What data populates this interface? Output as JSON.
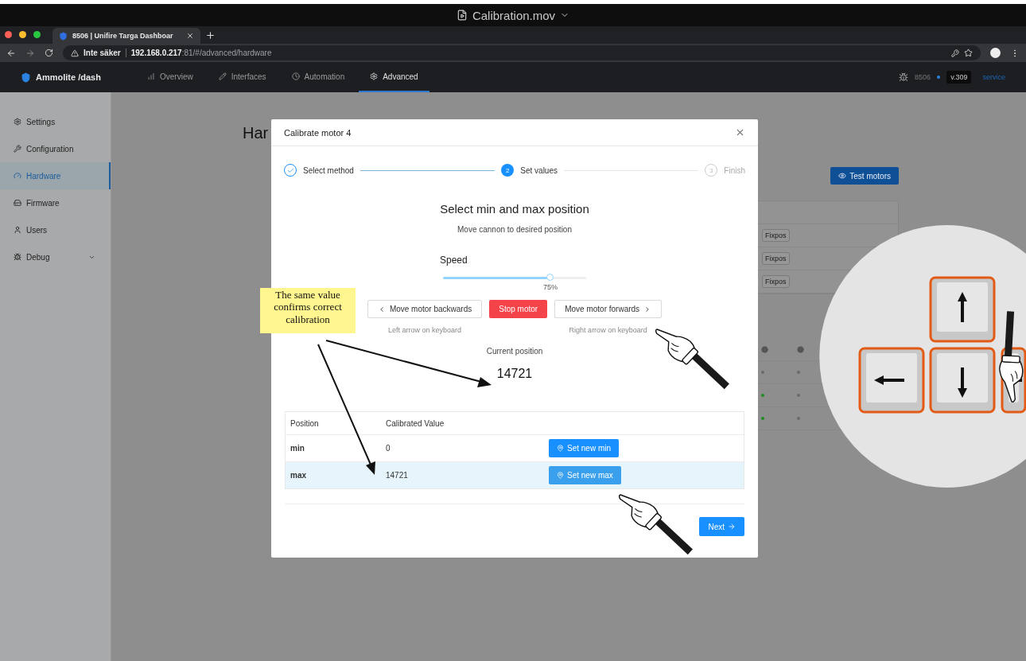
{
  "video_title": "Calibration.mov",
  "browser": {
    "tab_title": "8506 | Unifire Targa Dashboar",
    "security": "Inte säker",
    "url": "**192.168.0.217**:81/#/advanced/hardware"
  },
  "app_nav": {
    "brand": "Ammolite /dash",
    "items": [
      {
        "label": "Overview",
        "selected": false
      },
      {
        "label": "Interfaces",
        "selected": false
      },
      {
        "label": "Automation",
        "selected": false
      },
      {
        "label": "Advanced",
        "selected": true
      }
    ],
    "device": "8506",
    "version": "v.309",
    "service_link": "service"
  },
  "sidebar": {
    "items": [
      {
        "label": "Settings",
        "selected": false,
        "expandable": false
      },
      {
        "label": "Configuration",
        "selected": false,
        "expandable": false
      },
      {
        "label": "Hardware",
        "selected": true,
        "expandable": false
      },
      {
        "label": "Firmware",
        "selected": false,
        "expandable": false
      },
      {
        "label": "Users",
        "selected": false,
        "expandable": false
      },
      {
        "label": "Debug",
        "selected": false,
        "expandable": true
      }
    ]
  },
  "page": {
    "heading": "Har",
    "test_button": "Test motors",
    "tags": [
      "Fixpos",
      "Fixpos",
      "Fixpos"
    ],
    "dot_rows": [
      {
        "dots": [
          {
            "color": "#6a6a6a"
          },
          {
            "color": "#6a6a6a"
          }
        ]
      },
      {
        "dots": [
          {
            "color": "#1e8c1e"
          },
          {
            "color": "#6a6a6a"
          }
        ]
      },
      {
        "dots": [
          {
            "color": "#1e8c1e"
          },
          {
            "color": "#6a6a6a"
          }
        ]
      }
    ]
  },
  "modal": {
    "title": "Calibrate motor 4",
    "steps": [
      {
        "label": "Select method",
        "completed": true,
        "selected": false
      },
      {
        "number": "2",
        "label": "Set values",
        "completed": false,
        "selected": true
      },
      {
        "number": "3",
        "label": "Finish",
        "completed": false,
        "selected": false
      }
    ],
    "heading": "Select min and max position",
    "subheading": "Move cannon to desired position",
    "speed": {
      "label": "Speed",
      "level": 0.75,
      "reading": "75%"
    },
    "controls": [
      {
        "kind": "backward",
        "label": "Move motor backwards",
        "hint": "Left arrow on keyboard"
      },
      {
        "kind": "stop",
        "label": "Stop motor"
      },
      {
        "kind": "forward",
        "label": "Move motor forwards",
        "hint": "Right arrow on keyboard"
      }
    ],
    "position_label": "Current position",
    "position_value": "14721",
    "table": {
      "columns": [
        "Position",
        "Calibrated Value"
      ],
      "rows": [
        {
          "position": "min",
          "value": "0",
          "action": "Set new min",
          "selected": false
        },
        {
          "position": "max",
          "value": "14721",
          "action": "Set new max",
          "selected": true
        }
      ]
    },
    "next_button": "Next"
  },
  "annotation": {
    "note": "The same value confirms correct calibration"
  }
}
